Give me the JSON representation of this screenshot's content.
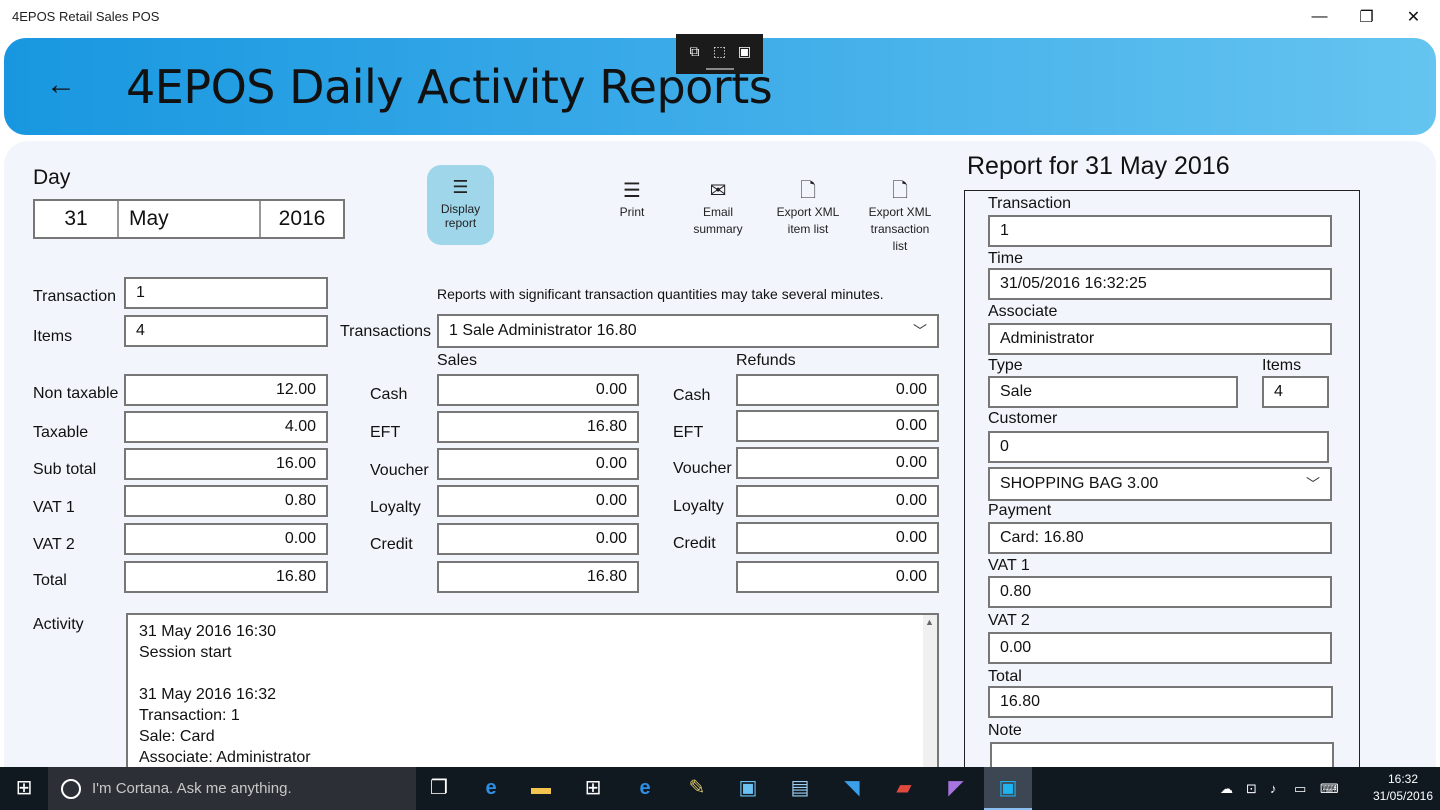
{
  "window": {
    "title": "4EPOS Retail Sales POS",
    "minimize_glyph": "—",
    "maximize_glyph": "❐",
    "close_glyph": "✕"
  },
  "header": {
    "back_glyph": "←",
    "title": "4EPOS Daily Activity Reports"
  },
  "day": {
    "label": "Day",
    "day": "31",
    "month": "May",
    "year": "2016"
  },
  "toolbar": {
    "display_report": "Display report",
    "print": "Print",
    "email_summary": "Email summary",
    "export_xml_item_list": "Export XML item list",
    "export_xml_transaction_list": "Export XML transaction list"
  },
  "notice": "Reports with significant transaction quantities may take several minutes.",
  "summary": {
    "transaction_label": "Transaction",
    "transaction": "1",
    "items_label": "Items",
    "items": "4",
    "non_taxable_label": "Non taxable",
    "non_taxable": "12.00",
    "taxable_label": "Taxable",
    "taxable": "4.00",
    "sub_total_label": "Sub total",
    "sub_total": "16.00",
    "vat1_label": "VAT 1",
    "vat1": "0.80",
    "vat2_label": "VAT 2",
    "vat2": "0.00",
    "total_label": "Total",
    "total": "16.80"
  },
  "transactions": {
    "label": "Transactions",
    "selected": "1 Sale Administrator 16.80"
  },
  "sales": {
    "header": "Sales",
    "rows": [
      {
        "label": "Cash",
        "value": "0.00"
      },
      {
        "label": "EFT",
        "value": "16.80"
      },
      {
        "label": "Voucher",
        "value": "0.00"
      },
      {
        "label": "Loyalty",
        "value": "0.00"
      },
      {
        "label": "Credit",
        "value": "0.00"
      }
    ],
    "total": "16.80"
  },
  "refunds": {
    "header": "Refunds",
    "rows": [
      {
        "label": "Cash",
        "value": "0.00"
      },
      {
        "label": "EFT",
        "value": "0.00"
      },
      {
        "label": "Voucher",
        "value": "0.00"
      },
      {
        "label": "Loyalty",
        "value": "0.00"
      },
      {
        "label": "Credit",
        "value": "0.00"
      }
    ],
    "total": "0.00"
  },
  "activity": {
    "label": "Activity",
    "lines": [
      "31 May 2016  16:30",
      "Session start",
      "",
      "31 May 2016  16:32",
      "Transaction: 1",
      "Sale: Card",
      "Associate: Administrator"
    ]
  },
  "report": {
    "title": "Report for 31 May 2016",
    "transaction_label": "Transaction",
    "transaction": "1",
    "time_label": "Time",
    "time": "31/05/2016 16:32:25",
    "associate_label": "Associate",
    "associate": "Administrator",
    "type_label": "Type",
    "type": "Sale",
    "items_label": "Items",
    "items": "4",
    "customer_label": "Customer",
    "customer": "0",
    "line_item": "SHOPPING BAG 3.00",
    "payment_label": "Payment",
    "payment": "Card: 16.80",
    "vat1_label": "VAT 1",
    "vat1": "0.80",
    "vat2_label": "VAT 2",
    "vat2": "0.00",
    "total_label": "Total",
    "total": "16.80",
    "note_label": "Note",
    "note": ""
  },
  "taskbar": {
    "cortana_placeholder": "I'm Cortana. Ask me anything.",
    "time": "16:32",
    "date": "31/05/2016",
    "apps": [
      "task-view-icon",
      "edge-icon",
      "file-explorer-icon",
      "store-icon",
      "internet-explorer-icon",
      "paint-icon",
      "app-icon",
      "image-app-icon",
      "vscode-icon",
      "pdf-icon",
      "visual-studio-icon",
      "4epos-icon"
    ]
  }
}
